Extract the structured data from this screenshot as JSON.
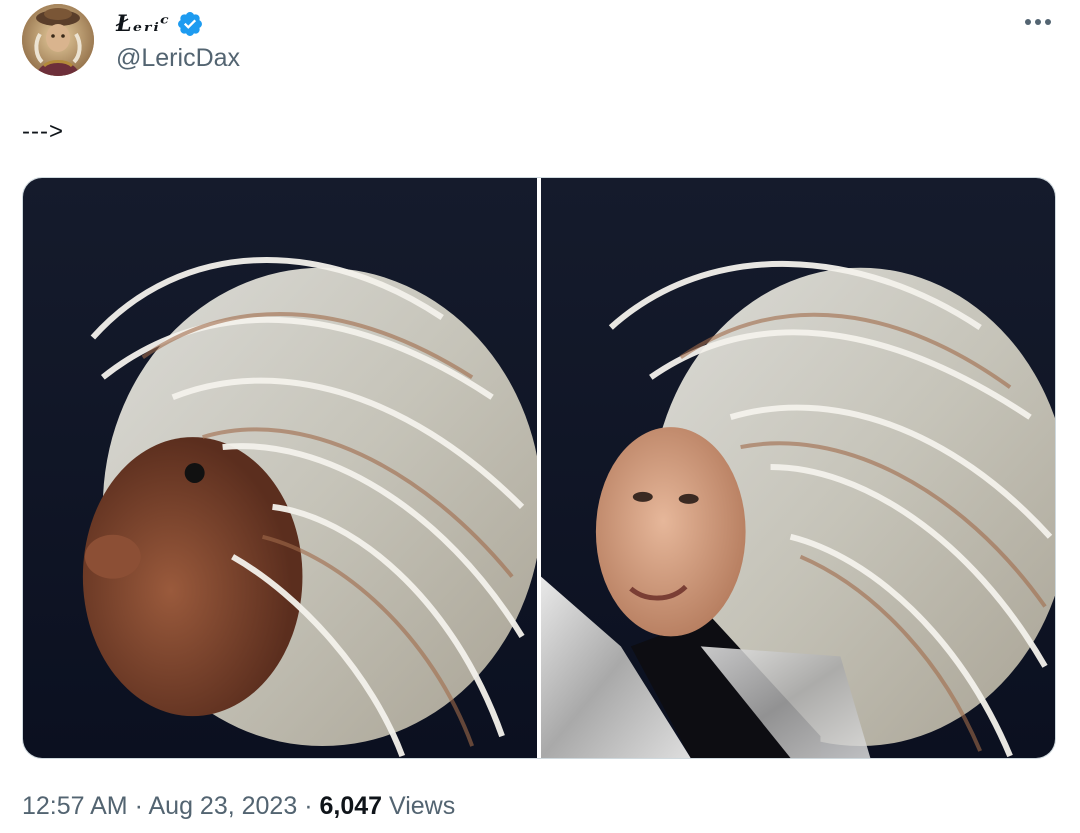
{
  "author": {
    "display_name": "Łₑᵣᵢᶜ",
    "handle": "@LericDax",
    "verified": true,
    "verified_color": "#1d9bf0",
    "avatar_icon": "avatar-image"
  },
  "tweet": {
    "text": "--->",
    "more_icon": "more-options-icon"
  },
  "media": {
    "images": [
      {
        "alt": "photo-1"
      },
      {
        "alt": "photo-2"
      }
    ]
  },
  "meta": {
    "time": "12:57 AM",
    "separator": "·",
    "date": "Aug 23, 2023",
    "views_count": "6,047",
    "views_label": "Views"
  },
  "colors": {
    "text_primary": "#0f1419",
    "text_secondary": "#536471",
    "border": "#cfd9de",
    "verified": "#1d9bf0"
  }
}
